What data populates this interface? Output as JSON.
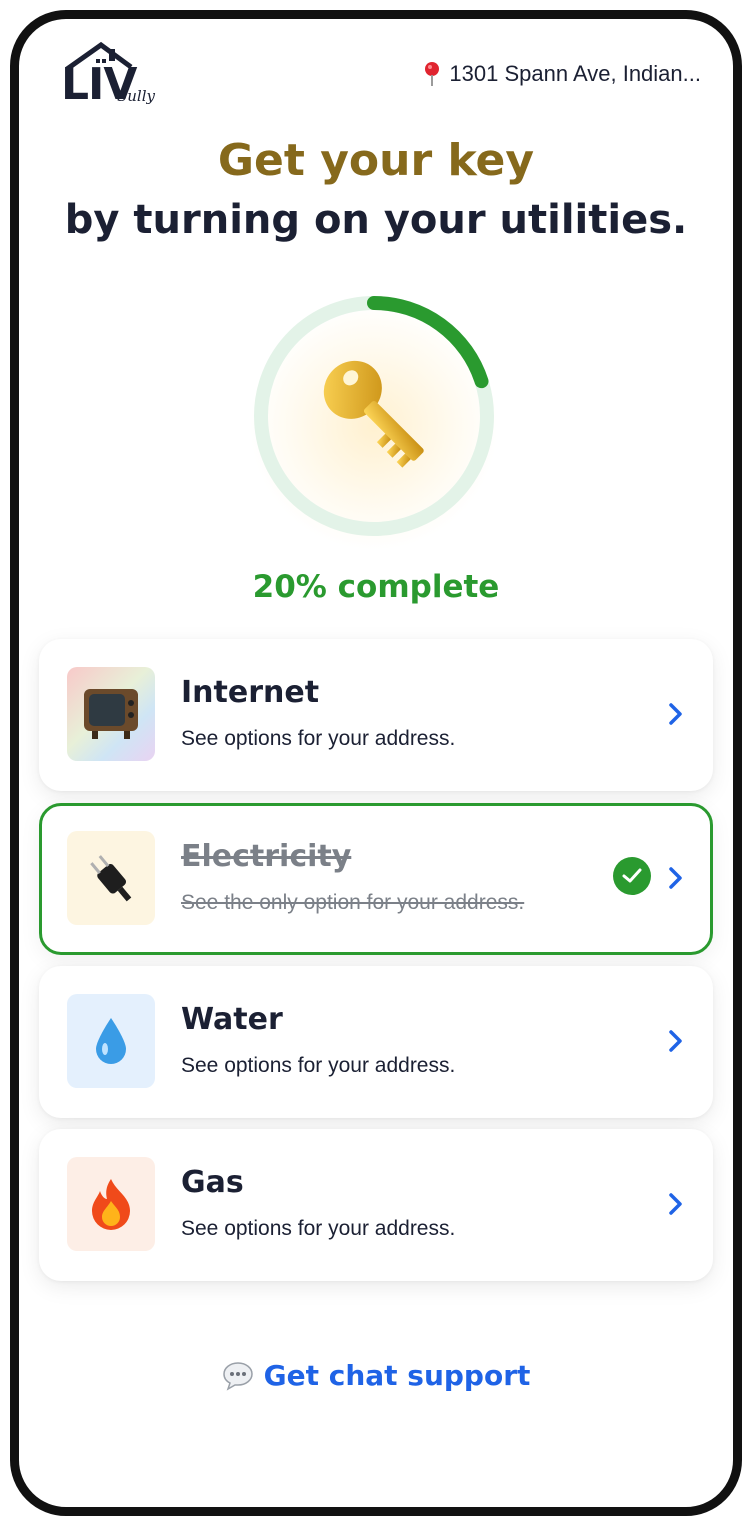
{
  "header": {
    "logo_text": "LIV",
    "logo_script": "Sully",
    "address": "1301 Spann Ave, Indian..."
  },
  "headline": {
    "line1": "Get your key",
    "line2": "by turning on your utilities."
  },
  "progress": {
    "percent": 20,
    "label": "20% complete"
  },
  "utilities": [
    {
      "title": "Internet",
      "subtitle": "See options for your address.",
      "icon": "tv-icon",
      "completed": false
    },
    {
      "title": "Electricity",
      "subtitle": "See the only option for your address.",
      "icon": "plug-icon",
      "completed": true
    },
    {
      "title": "Water",
      "subtitle": "See options for your address.",
      "icon": "water-drop-icon",
      "completed": false
    },
    {
      "title": "Gas",
      "subtitle": "See options for your address.",
      "icon": "fire-icon",
      "completed": false
    }
  ],
  "chat": {
    "label": "Get chat support"
  },
  "colors": {
    "gold": "#86691c",
    "navy": "#1b2033",
    "green": "#2a9a2f",
    "blue": "#1f63e6"
  }
}
